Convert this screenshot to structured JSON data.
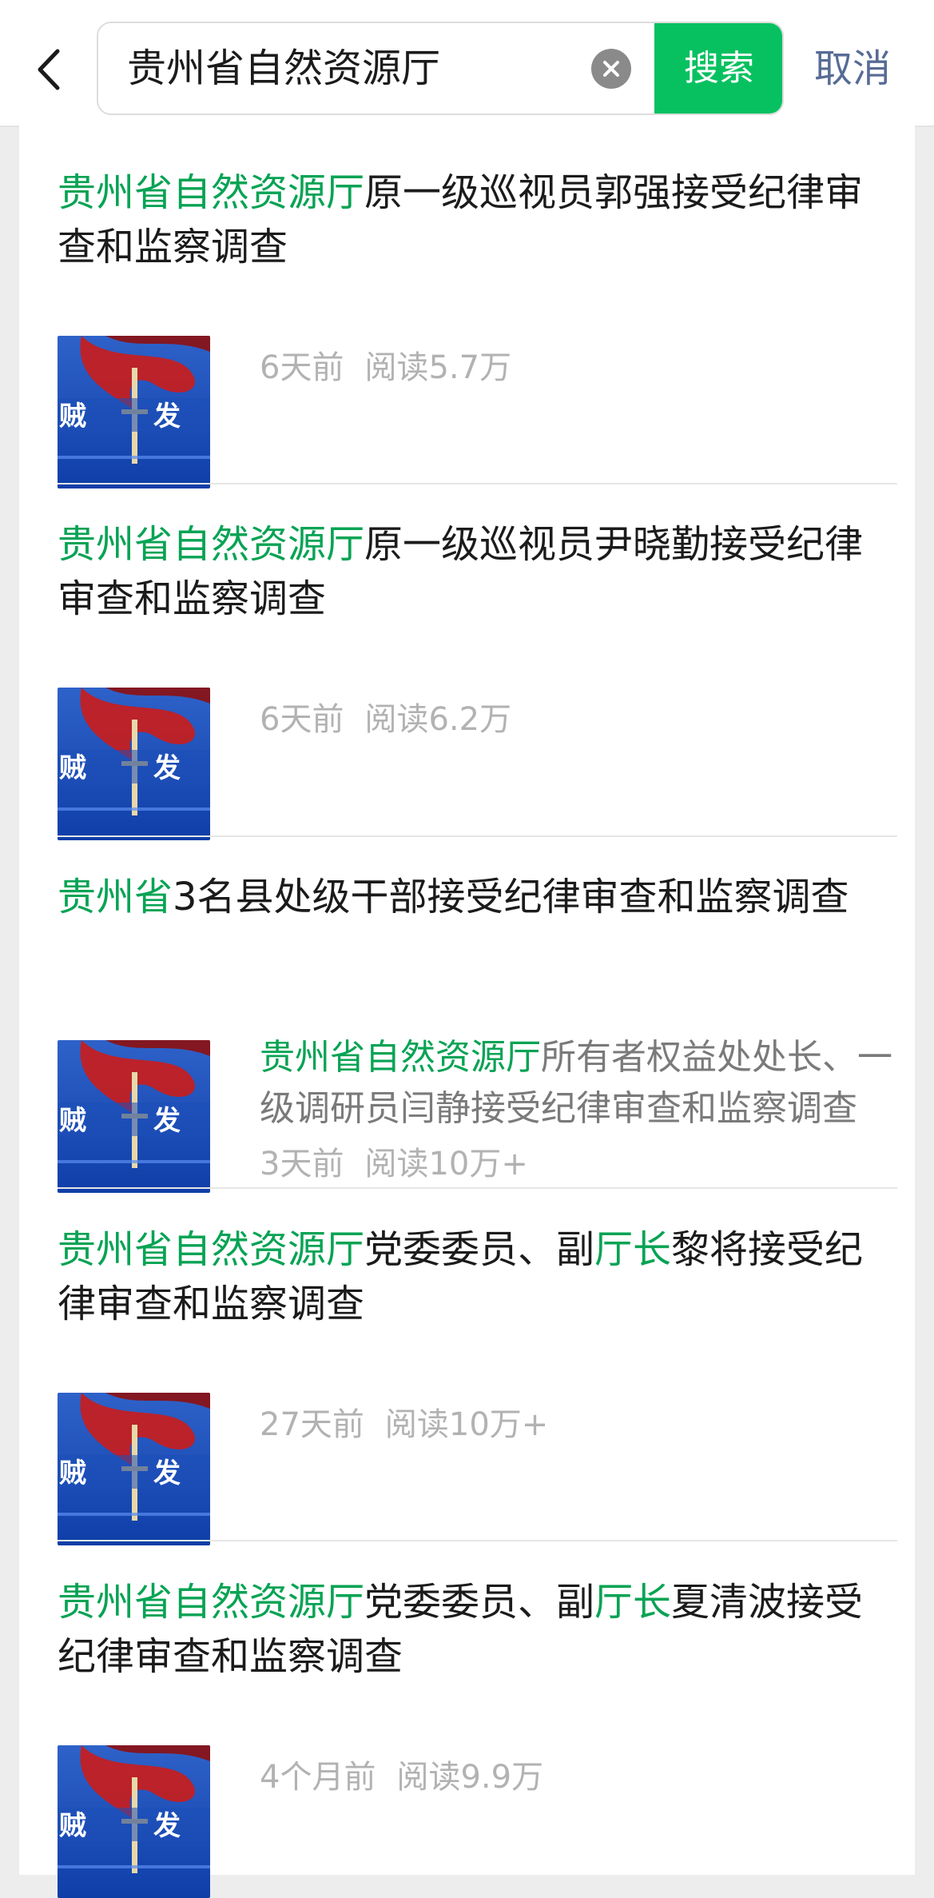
{
  "header": {
    "search_query": "贵州省自然资源厅",
    "search_label": "搜索",
    "cancel_label": "取消"
  },
  "theme": {
    "accent": "#07c160",
    "highlight": "#07a354",
    "link": "#576b95"
  },
  "results": [
    {
      "title_parts": [
        {
          "text": "贵州省自然资源厅",
          "hl": true
        },
        {
          "text": "原一级巡视员郭强接受纪律审查和监察调查",
          "hl": false
        }
      ],
      "time": "6天前",
      "reads": "阅读5.7万"
    },
    {
      "title_parts": [
        {
          "text": "贵州省自然资源厅",
          "hl": true
        },
        {
          "text": "原一级巡视员尹晓勤接受纪律审查和监察调查",
          "hl": false
        }
      ],
      "time": "6天前",
      "reads": "阅读6.2万"
    },
    {
      "title_parts": [
        {
          "text": "贵州省",
          "hl": true
        },
        {
          "text": "3名县处级干部接受纪律审查和监察调查",
          "hl": false
        }
      ],
      "snippet_parts": [
        {
          "text": "贵州省自然资源厅",
          "hl": true
        },
        {
          "text": "所有者权益处处长、一级调研员闫静接受纪律审查和监察调查",
          "hl": false
        }
      ],
      "time": "3天前",
      "reads": "阅读10万+"
    },
    {
      "title_parts": [
        {
          "text": "贵州省自然资源厅",
          "hl": true
        },
        {
          "text": "党委委员、副",
          "hl": false
        },
        {
          "text": "厅长",
          "hl": true
        },
        {
          "text": "黎将接受纪律审查和监察调查",
          "hl": false
        }
      ],
      "time": "27天前",
      "reads": "阅读10万+"
    },
    {
      "title_parts": [
        {
          "text": "贵州省自然资源厅",
          "hl": true
        },
        {
          "text": "党委委员、副",
          "hl": false
        },
        {
          "text": "厅长",
          "hl": true
        },
        {
          "text": "夏清波接受纪律审查和监察调查",
          "hl": false
        }
      ],
      "time": "4个月前",
      "reads": "阅读9.9万"
    }
  ]
}
